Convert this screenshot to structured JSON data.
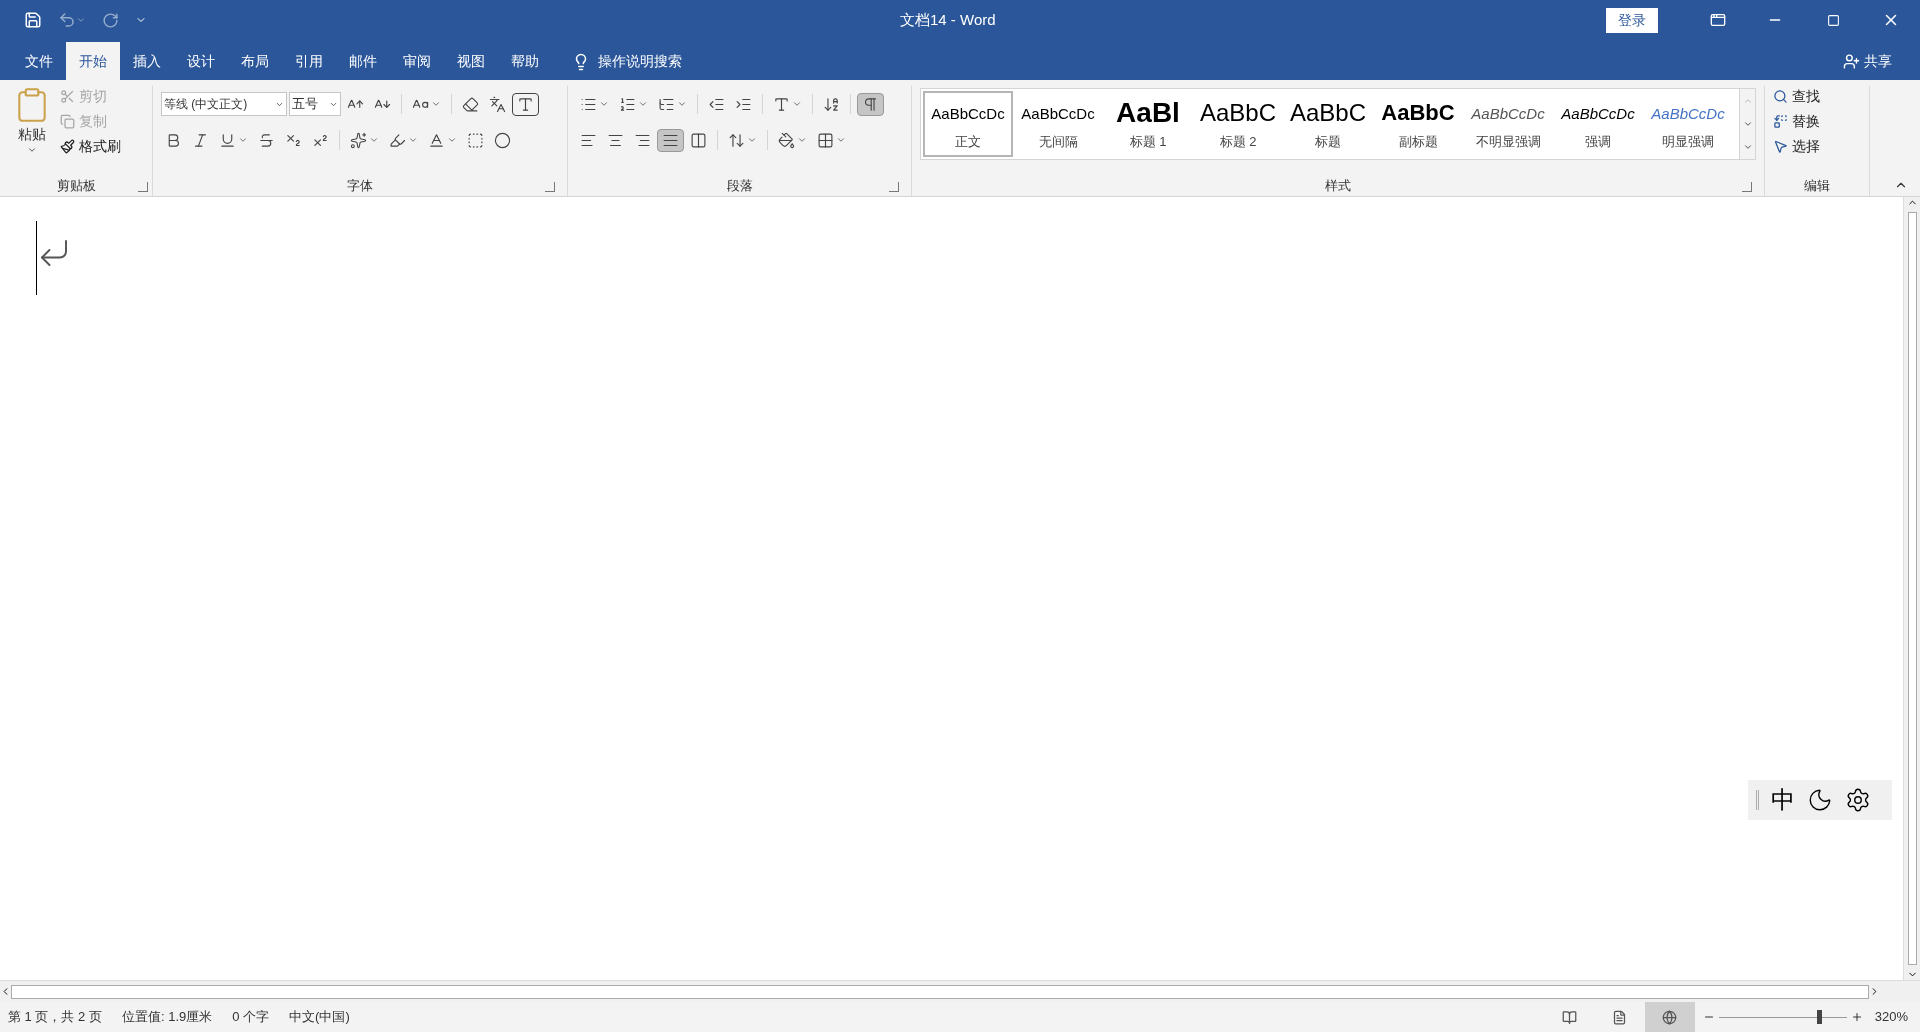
{
  "window": {
    "title": "文档14 - Word",
    "login": "登录",
    "share": "共享"
  },
  "tabs": [
    {
      "label": "文件",
      "selected": false
    },
    {
      "label": "开始",
      "selected": true
    },
    {
      "label": "插入",
      "selected": false
    },
    {
      "label": "设计",
      "selected": false
    },
    {
      "label": "布局",
      "selected": false
    },
    {
      "label": "引用",
      "selected": false
    },
    {
      "label": "邮件",
      "selected": false
    },
    {
      "label": "审阅",
      "selected": false
    },
    {
      "label": "视图",
      "selected": false
    },
    {
      "label": "帮助",
      "selected": false
    }
  ],
  "tell_me": "操作说明搜索",
  "clipboard": {
    "label": "剪贴板",
    "paste": "粘贴",
    "items": [
      {
        "label": "剪切",
        "disabled": true
      },
      {
        "label": "复制",
        "disabled": true
      },
      {
        "label": "格式刷",
        "disabled": false
      }
    ]
  },
  "font": {
    "label": "字体",
    "font_name": "等线 (中文正文)",
    "font_size": "五号"
  },
  "paragraph": {
    "label": "段落",
    "show_marks": true,
    "alignments": [
      {
        "kind": "left",
        "selected": false
      },
      {
        "kind": "center",
        "selected": false
      },
      {
        "kind": "right",
        "selected": false
      },
      {
        "kind": "justify",
        "selected": true
      },
      {
        "kind": "distributed",
        "selected": false
      }
    ]
  },
  "styles": {
    "label": "样式",
    "items": [
      {
        "kind": "normal",
        "preview": "AaBbCcDc",
        "name": "正文",
        "selected": true
      },
      {
        "kind": "no_spacing",
        "preview": "AaBbCcDc",
        "name": "无间隔",
        "selected": false
      },
      {
        "kind": "heading1",
        "preview": "AaBl",
        "name": "标题 1",
        "selected": false
      },
      {
        "kind": "heading2",
        "preview": "AaBbC",
        "name": "标题 2",
        "selected": false
      },
      {
        "kind": "title",
        "preview": "AaBbC",
        "name": "标题",
        "selected": false
      },
      {
        "kind": "subtitle",
        "preview": "AaBbC",
        "name": "副标题",
        "selected": false
      },
      {
        "kind": "subtle",
        "preview": "AaBbCcDc",
        "name": "不明显强调",
        "selected": false
      },
      {
        "kind": "emphasis",
        "preview": "AaBbCcDc",
        "name": "强调",
        "selected": false
      },
      {
        "kind": "intense",
        "preview": "AaBbCcDc",
        "name": "明显强调",
        "selected": false
      }
    ]
  },
  "editing": {
    "label": "编辑",
    "items": [
      {
        "kind": "find",
        "label": "查找"
      },
      {
        "kind": "replace",
        "label": "替换"
      },
      {
        "kind": "select",
        "label": "选择"
      }
    ]
  },
  "ime": {
    "mode": "中"
  },
  "status_bar": {
    "items": [
      "第 1 页，共 2 页",
      "位置值: 1.9厘米",
      "0 个字",
      "中文(中国)"
    ],
    "views": [
      {
        "selected": false
      },
      {
        "selected": false
      },
      {
        "selected": true
      }
    ],
    "zoom": {
      "level": 0.78,
      "reading": "320%"
    }
  }
}
